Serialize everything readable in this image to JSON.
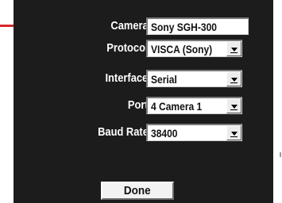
{
  "fields": {
    "camera": {
      "label": "Camera:",
      "value": "Sony SGH-300"
    },
    "protocol": {
      "label": "Protocol:",
      "value": "VISCA (Sony)"
    },
    "interface": {
      "label": "Interface:",
      "value": "Serial"
    },
    "port": {
      "label": "Port:",
      "value": "4 Camera 1"
    },
    "baud_rate": {
      "label": "Baud Rate:",
      "value": "38400"
    }
  },
  "buttons": {
    "done": "Done"
  },
  "colors": {
    "panel": "#1c1c1c",
    "callout": "#d8262c",
    "label": "#ffffff"
  },
  "icons": {
    "dropdown": "chevron-down-icon"
  }
}
